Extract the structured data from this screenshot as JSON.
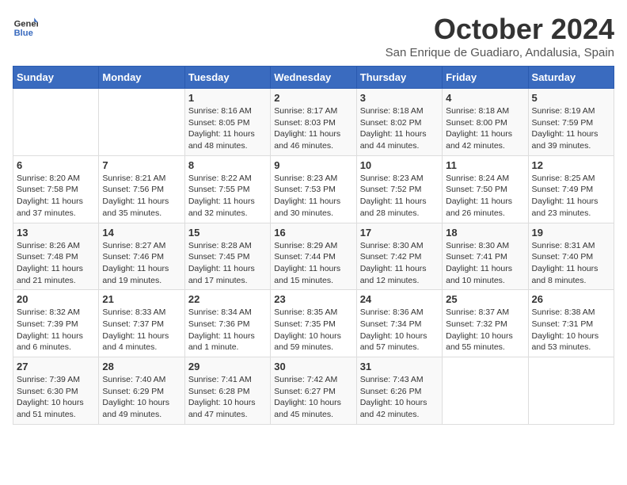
{
  "header": {
    "logo_line1": "General",
    "logo_line2": "Blue",
    "month": "October 2024",
    "location": "San Enrique de Guadiaro, Andalusia, Spain"
  },
  "days_of_week": [
    "Sunday",
    "Monday",
    "Tuesday",
    "Wednesday",
    "Thursday",
    "Friday",
    "Saturday"
  ],
  "weeks": [
    [
      {
        "day": "",
        "sunrise": "",
        "sunset": "",
        "daylight": ""
      },
      {
        "day": "",
        "sunrise": "",
        "sunset": "",
        "daylight": ""
      },
      {
        "day": "1",
        "sunrise": "Sunrise: 8:16 AM",
        "sunset": "Sunset: 8:05 PM",
        "daylight": "Daylight: 11 hours and 48 minutes."
      },
      {
        "day": "2",
        "sunrise": "Sunrise: 8:17 AM",
        "sunset": "Sunset: 8:03 PM",
        "daylight": "Daylight: 11 hours and 46 minutes."
      },
      {
        "day": "3",
        "sunrise": "Sunrise: 8:18 AM",
        "sunset": "Sunset: 8:02 PM",
        "daylight": "Daylight: 11 hours and 44 minutes."
      },
      {
        "day": "4",
        "sunrise": "Sunrise: 8:18 AM",
        "sunset": "Sunset: 8:00 PM",
        "daylight": "Daylight: 11 hours and 42 minutes."
      },
      {
        "day": "5",
        "sunrise": "Sunrise: 8:19 AM",
        "sunset": "Sunset: 7:59 PM",
        "daylight": "Daylight: 11 hours and 39 minutes."
      }
    ],
    [
      {
        "day": "6",
        "sunrise": "Sunrise: 8:20 AM",
        "sunset": "Sunset: 7:58 PM",
        "daylight": "Daylight: 11 hours and 37 minutes."
      },
      {
        "day": "7",
        "sunrise": "Sunrise: 8:21 AM",
        "sunset": "Sunset: 7:56 PM",
        "daylight": "Daylight: 11 hours and 35 minutes."
      },
      {
        "day": "8",
        "sunrise": "Sunrise: 8:22 AM",
        "sunset": "Sunset: 7:55 PM",
        "daylight": "Daylight: 11 hours and 32 minutes."
      },
      {
        "day": "9",
        "sunrise": "Sunrise: 8:23 AM",
        "sunset": "Sunset: 7:53 PM",
        "daylight": "Daylight: 11 hours and 30 minutes."
      },
      {
        "day": "10",
        "sunrise": "Sunrise: 8:23 AM",
        "sunset": "Sunset: 7:52 PM",
        "daylight": "Daylight: 11 hours and 28 minutes."
      },
      {
        "day": "11",
        "sunrise": "Sunrise: 8:24 AM",
        "sunset": "Sunset: 7:50 PM",
        "daylight": "Daylight: 11 hours and 26 minutes."
      },
      {
        "day": "12",
        "sunrise": "Sunrise: 8:25 AM",
        "sunset": "Sunset: 7:49 PM",
        "daylight": "Daylight: 11 hours and 23 minutes."
      }
    ],
    [
      {
        "day": "13",
        "sunrise": "Sunrise: 8:26 AM",
        "sunset": "Sunset: 7:48 PM",
        "daylight": "Daylight: 11 hours and 21 minutes."
      },
      {
        "day": "14",
        "sunrise": "Sunrise: 8:27 AM",
        "sunset": "Sunset: 7:46 PM",
        "daylight": "Daylight: 11 hours and 19 minutes."
      },
      {
        "day": "15",
        "sunrise": "Sunrise: 8:28 AM",
        "sunset": "Sunset: 7:45 PM",
        "daylight": "Daylight: 11 hours and 17 minutes."
      },
      {
        "day": "16",
        "sunrise": "Sunrise: 8:29 AM",
        "sunset": "Sunset: 7:44 PM",
        "daylight": "Daylight: 11 hours and 15 minutes."
      },
      {
        "day": "17",
        "sunrise": "Sunrise: 8:30 AM",
        "sunset": "Sunset: 7:42 PM",
        "daylight": "Daylight: 11 hours and 12 minutes."
      },
      {
        "day": "18",
        "sunrise": "Sunrise: 8:30 AM",
        "sunset": "Sunset: 7:41 PM",
        "daylight": "Daylight: 11 hours and 10 minutes."
      },
      {
        "day": "19",
        "sunrise": "Sunrise: 8:31 AM",
        "sunset": "Sunset: 7:40 PM",
        "daylight": "Daylight: 11 hours and 8 minutes."
      }
    ],
    [
      {
        "day": "20",
        "sunrise": "Sunrise: 8:32 AM",
        "sunset": "Sunset: 7:39 PM",
        "daylight": "Daylight: 11 hours and 6 minutes."
      },
      {
        "day": "21",
        "sunrise": "Sunrise: 8:33 AM",
        "sunset": "Sunset: 7:37 PM",
        "daylight": "Daylight: 11 hours and 4 minutes."
      },
      {
        "day": "22",
        "sunrise": "Sunrise: 8:34 AM",
        "sunset": "Sunset: 7:36 PM",
        "daylight": "Daylight: 11 hours and 1 minute."
      },
      {
        "day": "23",
        "sunrise": "Sunrise: 8:35 AM",
        "sunset": "Sunset: 7:35 PM",
        "daylight": "Daylight: 10 hours and 59 minutes."
      },
      {
        "day": "24",
        "sunrise": "Sunrise: 8:36 AM",
        "sunset": "Sunset: 7:34 PM",
        "daylight": "Daylight: 10 hours and 57 minutes."
      },
      {
        "day": "25",
        "sunrise": "Sunrise: 8:37 AM",
        "sunset": "Sunset: 7:32 PM",
        "daylight": "Daylight: 10 hours and 55 minutes."
      },
      {
        "day": "26",
        "sunrise": "Sunrise: 8:38 AM",
        "sunset": "Sunset: 7:31 PM",
        "daylight": "Daylight: 10 hours and 53 minutes."
      }
    ],
    [
      {
        "day": "27",
        "sunrise": "Sunrise: 7:39 AM",
        "sunset": "Sunset: 6:30 PM",
        "daylight": "Daylight: 10 hours and 51 minutes."
      },
      {
        "day": "28",
        "sunrise": "Sunrise: 7:40 AM",
        "sunset": "Sunset: 6:29 PM",
        "daylight": "Daylight: 10 hours and 49 minutes."
      },
      {
        "day": "29",
        "sunrise": "Sunrise: 7:41 AM",
        "sunset": "Sunset: 6:28 PM",
        "daylight": "Daylight: 10 hours and 47 minutes."
      },
      {
        "day": "30",
        "sunrise": "Sunrise: 7:42 AM",
        "sunset": "Sunset: 6:27 PM",
        "daylight": "Daylight: 10 hours and 45 minutes."
      },
      {
        "day": "31",
        "sunrise": "Sunrise: 7:43 AM",
        "sunset": "Sunset: 6:26 PM",
        "daylight": "Daylight: 10 hours and 42 minutes."
      },
      {
        "day": "",
        "sunrise": "",
        "sunset": "",
        "daylight": ""
      },
      {
        "day": "",
        "sunrise": "",
        "sunset": "",
        "daylight": ""
      }
    ]
  ]
}
